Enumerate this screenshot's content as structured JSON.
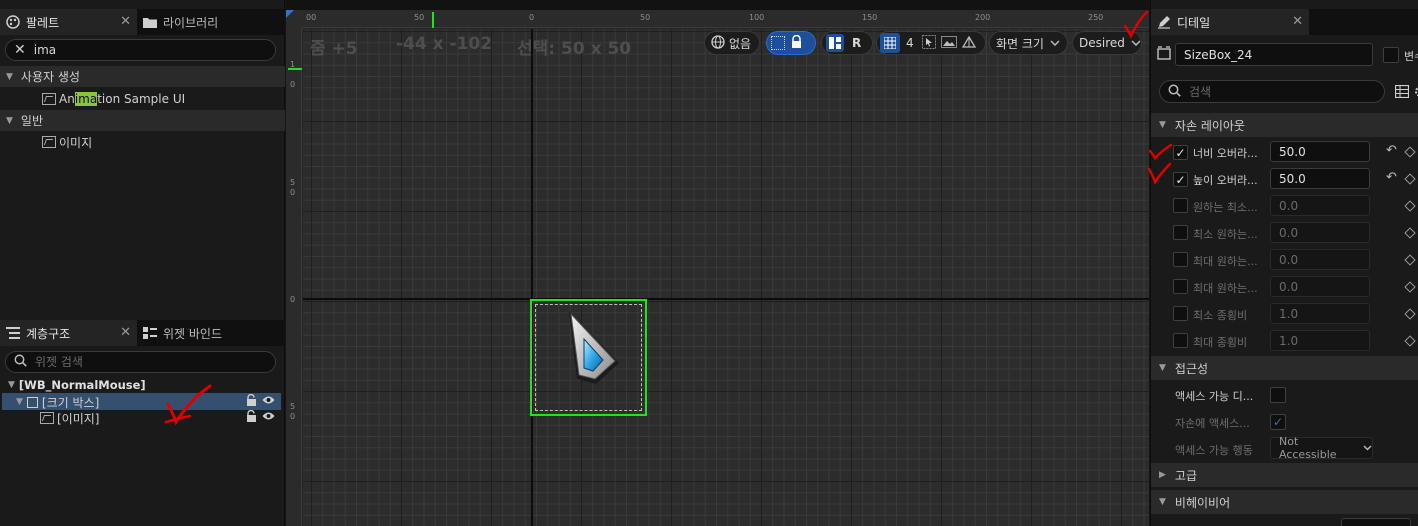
{
  "palette": {
    "tab_label": "팔레트",
    "library_tab_label": "라이브러리",
    "search_value": "ima",
    "categories": [
      {
        "label": "사용자 생성",
        "items": [
          {
            "pre": "An",
            "hl": "ima",
            "post": "tion Sample UI"
          }
        ]
      },
      {
        "label": "일반",
        "items": [
          {
            "label": "이미지"
          }
        ]
      }
    ]
  },
  "hierarchy": {
    "tab_label": "계층구조",
    "bindings_tab_label": "위젯 바인드",
    "search_placeholder": "위젯 검색",
    "root": "[WB_NormalMouse]",
    "nodes": [
      "[크기 박스]",
      "[이미지]"
    ]
  },
  "canvas": {
    "zoom": "줌 +5",
    "cursor_pos": "-44 x -102",
    "selection": "선택: 50 x 50",
    "ruler_top": [
      "00",
      "50",
      "0",
      "50",
      "100",
      "150",
      "200",
      "250"
    ],
    "ruler_left": [
      "1",
      "0",
      "5",
      "0",
      "0",
      "5",
      "0"
    ],
    "toolbar": {
      "localization": "없음",
      "r_label": "R",
      "grid_count": "4",
      "screen_size": "화면 크기",
      "fill_mode": "Desired"
    }
  },
  "details": {
    "tab_label": "디테일",
    "widget_name": "SizeBox_24",
    "variable_label": "변수",
    "search_placeholder": "검색",
    "sections": {
      "child_layout": "자손 레이아웃",
      "accessibility": "접근성",
      "advanced": "고급",
      "behavior": "비헤이비어"
    },
    "layout_props": [
      {
        "label": "너비 오버라...",
        "value": "50.0",
        "checked": true
      },
      {
        "label": "높이 오버라...",
        "value": "50.0",
        "checked": true
      },
      {
        "label": "원하는 최소...",
        "value": "0.0",
        "checked": false
      },
      {
        "label": "최소 원하는...",
        "value": "0.0",
        "checked": false
      },
      {
        "label": "최대 원하는...",
        "value": "0.0",
        "checked": false
      },
      {
        "label": "최대 원하는...",
        "value": "0.0",
        "checked": false
      },
      {
        "label": "최소 종횡비",
        "value": "1.0",
        "checked": false
      },
      {
        "label": "최대 종횡비",
        "value": "1.0",
        "checked": false
      }
    ],
    "access_props": {
      "accessible_label": "액세스 가능 디...",
      "child_access_label": "자손에 액세스...",
      "access_behavior_label": "액세스 가능 행동",
      "access_behavior_value": "Not Accessible"
    }
  }
}
